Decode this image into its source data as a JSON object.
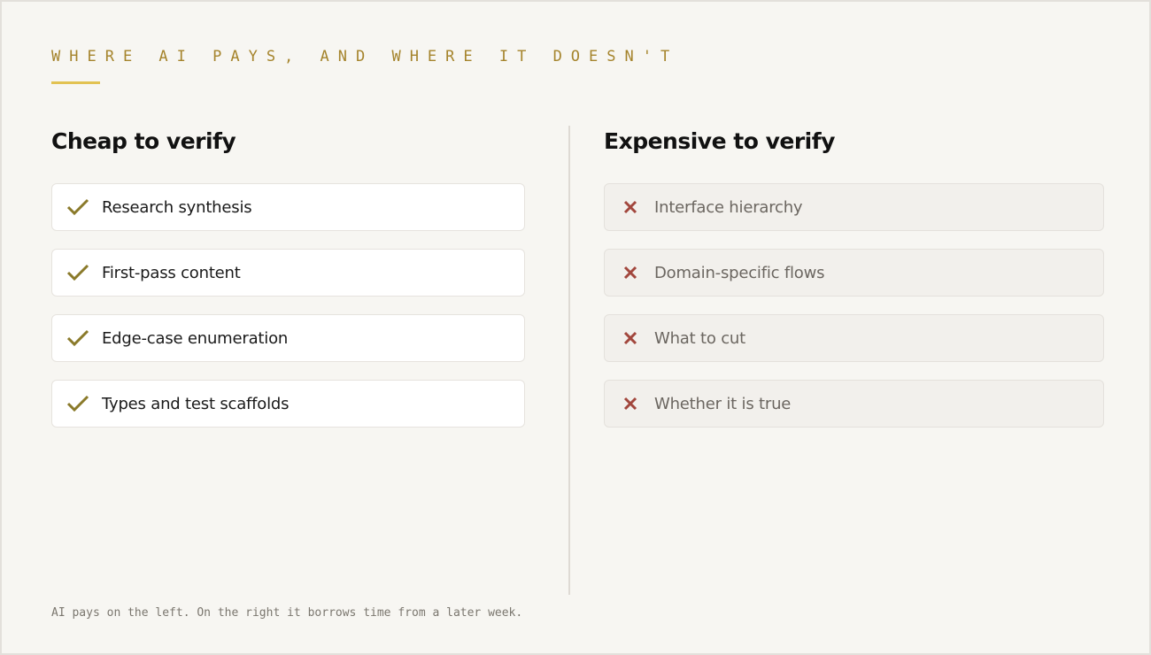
{
  "slide": {
    "eyebrow": "WHERE AI PAYS, AND WHERE IT DOESN'T",
    "footnote": "AI pays on the left. On the right it borrows time from a later week."
  },
  "colors": {
    "accent": "#a5842c",
    "accent_rule": "#e2c252",
    "check": "#8a7a2a",
    "cross": "#a2473d",
    "background": "#f7f6f2"
  },
  "left_column": {
    "title": "Cheap to verify",
    "icon": "check-icon",
    "items": [
      {
        "label": "Research synthesis"
      },
      {
        "label": "First-pass content"
      },
      {
        "label": "Edge-case enumeration"
      },
      {
        "label": "Types and test scaffolds"
      }
    ]
  },
  "right_column": {
    "title": "Expensive to verify",
    "icon": "x-icon",
    "items": [
      {
        "label": "Interface hierarchy"
      },
      {
        "label": "Domain-specific flows"
      },
      {
        "label": "What to cut"
      },
      {
        "label": "Whether it is true"
      }
    ]
  }
}
